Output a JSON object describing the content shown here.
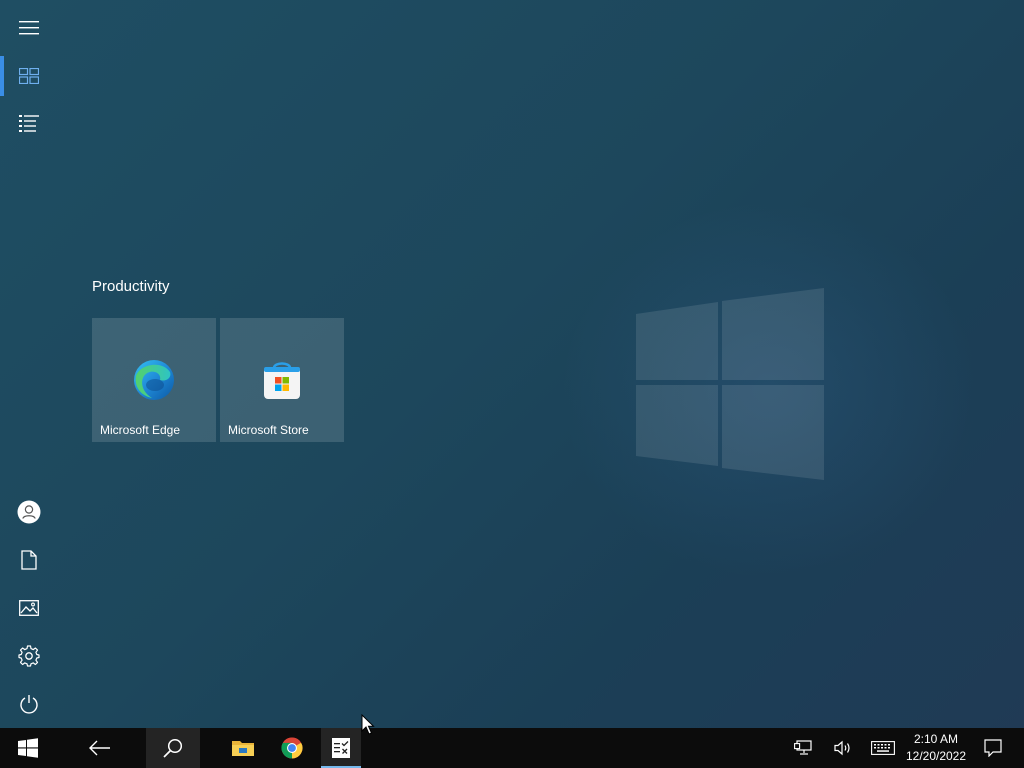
{
  "start_menu": {
    "rail_top": [
      {
        "icon": "hamburger-icon"
      },
      {
        "icon": "tiles-icon",
        "active": true
      },
      {
        "icon": "all-apps-list-icon"
      }
    ],
    "rail_bottom": [
      {
        "icon": "user-icon"
      },
      {
        "icon": "documents-icon"
      },
      {
        "icon": "pictures-icon"
      },
      {
        "icon": "settings-gear-icon"
      },
      {
        "icon": "power-icon"
      }
    ],
    "group_title": "Productivity",
    "tiles": [
      {
        "label": "Microsoft Edge",
        "icon": "edge-icon"
      },
      {
        "label": "Microsoft Store",
        "icon": "store-icon"
      }
    ]
  },
  "taskbar": {
    "apps": [
      {
        "icon": "windows-start-icon"
      },
      {
        "icon": "back-arrow-icon"
      },
      {
        "icon": "search-icon",
        "highlighted": true
      },
      {
        "icon": "file-explorer-icon"
      },
      {
        "icon": "chrome-icon"
      },
      {
        "icon": "task-app-icon",
        "active": true
      }
    ],
    "tray": [
      {
        "icon": "network-icon"
      },
      {
        "icon": "volume-icon"
      },
      {
        "icon": "keyboard-icon"
      }
    ],
    "clock": {
      "time": "2:10 AM",
      "date": "12/20/2022"
    },
    "notifications_icon": "action-center-icon"
  },
  "colors": {
    "accent": "#3a8ee6",
    "taskbar_bg": "#0c0c0c",
    "active_underline": "#76b9ed"
  }
}
